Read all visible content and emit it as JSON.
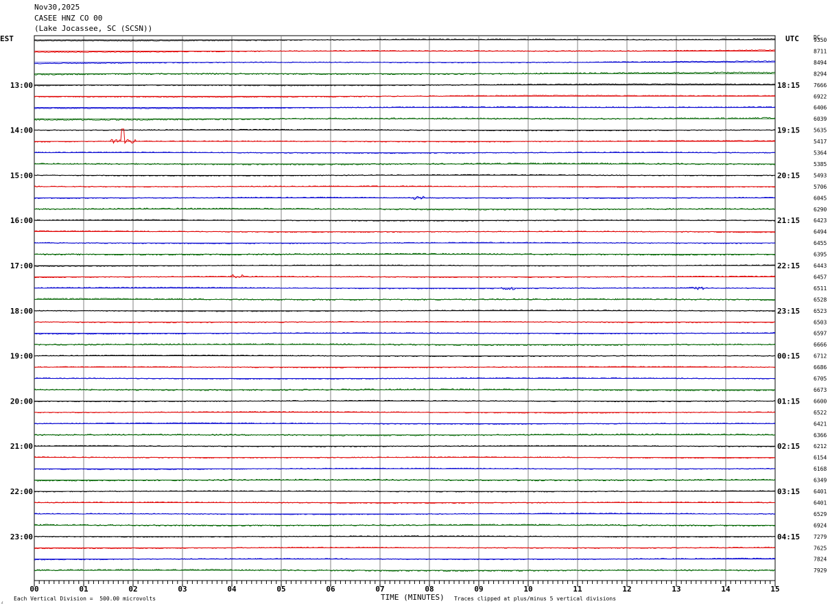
{
  "header": {
    "date": "Nov30,2025",
    "station": "CASEE HNZ CO 00",
    "location": "(Lake Jocassee, SC (SCSN))"
  },
  "left_tz": "EST",
  "right_tz": "UTC",
  "dc_header": "DC",
  "footer": {
    "mark": "⁁",
    "scale_note": "Each Vertical Division =  500.00 microvolts",
    "clip_note": "Traces clipped at plus/minus 5 vertical divisions"
  },
  "colors": {
    "trace_cycle": [
      "#000000",
      "#e00000",
      "#0000d0",
      "#006400"
    ],
    "grid": "#808080"
  },
  "chart_data": {
    "type": "line",
    "title": "CASEE HNZ CO 00",
    "xlabel": "TIME (MINUTES)",
    "ylabel": "",
    "xlim": [
      0,
      15
    ],
    "x_ticks": [
      "00",
      "01",
      "02",
      "03",
      "04",
      "05",
      "06",
      "07",
      "08",
      "09",
      "10",
      "11",
      "12",
      "13",
      "14",
      "15"
    ],
    "left_hour_labels": [
      "13:00",
      "14:00",
      "15:00",
      "16:00",
      "17:00",
      "18:00",
      "19:00",
      "20:00",
      "21:00",
      "22:00",
      "23:00"
    ],
    "right_hour_labels": [
      "18:15",
      "19:15",
      "20:15",
      "21:15",
      "22:15",
      "23:15",
      "00:15",
      "01:15",
      "02:15",
      "03:15",
      "04:15"
    ],
    "trace_count": 48,
    "dc_offsets": [
      "9350",
      "8711",
      "8494",
      "8294",
      "7666",
      "6922",
      "6406",
      "6039",
      "5635",
      "5417",
      "5364",
      "5385",
      "5493",
      "5706",
      "6045",
      "6290",
      "6423",
      "6494",
      "6455",
      "6395",
      "6443",
      "6457",
      "6511",
      "6528",
      "6523",
      "6503",
      "6597",
      "6666",
      "6712",
      "6686",
      "6705",
      "6673",
      "6600",
      "6522",
      "6421",
      "6366",
      "6212",
      "6154",
      "6168",
      "6349",
      "6401",
      "6401",
      "6529",
      "6924",
      "7279",
      "7625",
      "7824",
      "7929"
    ],
    "events": [
      {
        "trace": 9,
        "minute": 1.8,
        "note": "spike"
      },
      {
        "trace": 14,
        "minute": 7.75,
        "note": "burst"
      },
      {
        "trace": 21,
        "minute": 4.1,
        "note": "burst"
      },
      {
        "trace": 22,
        "minute": 9.6,
        "note": "burst"
      },
      {
        "trace": 22,
        "minute": 13.4,
        "note": "burst"
      }
    ]
  }
}
